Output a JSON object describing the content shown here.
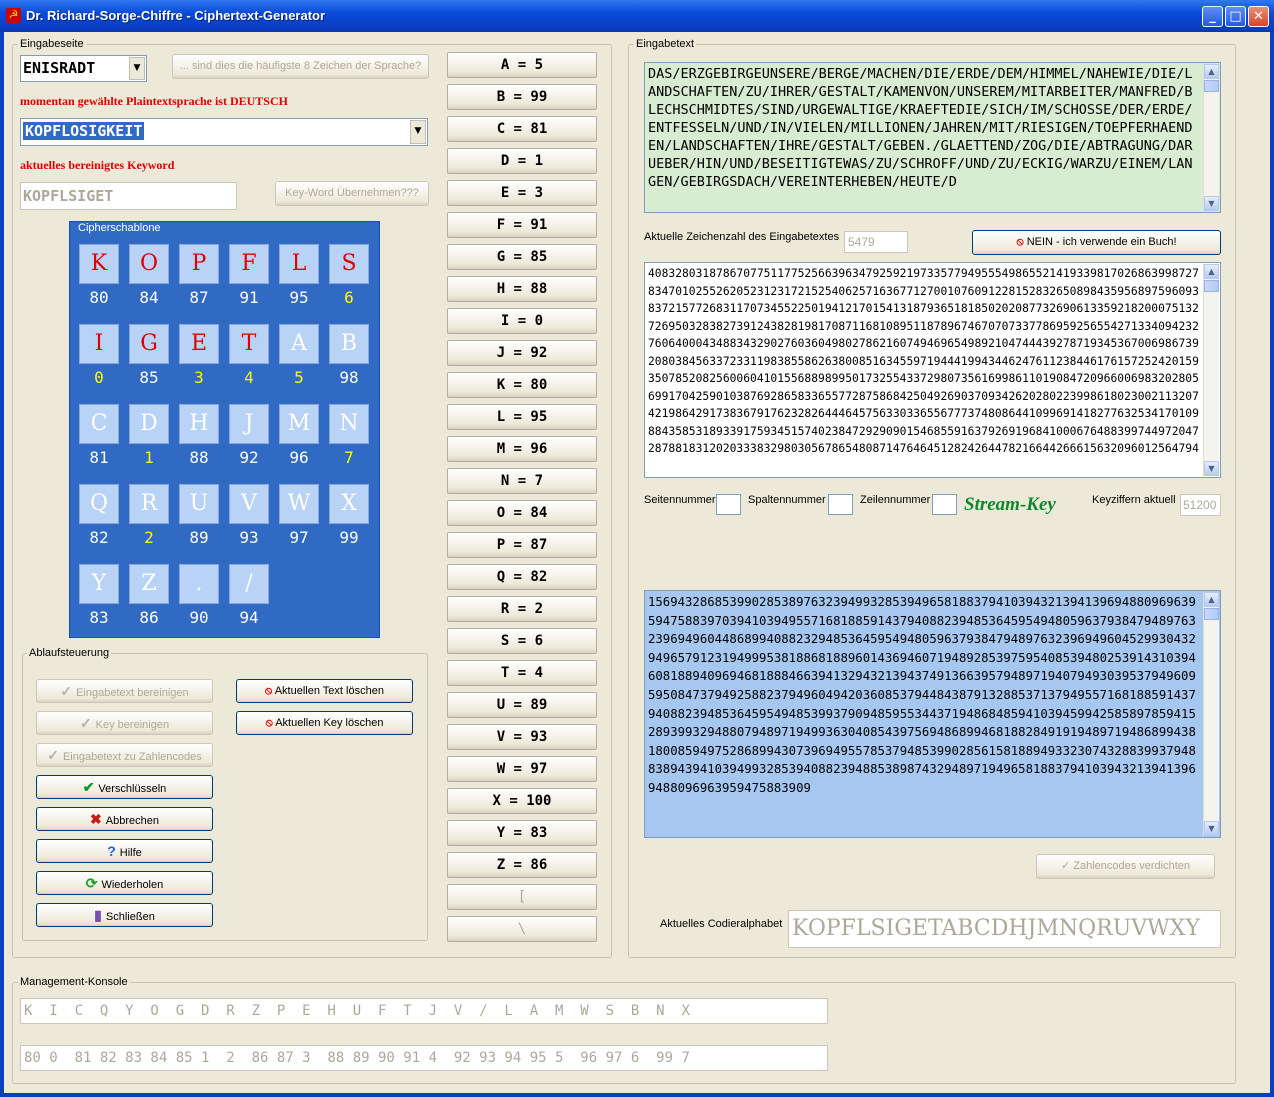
{
  "window": {
    "title": "Dr. Richard-Sorge-Chiffre - Ciphertext-Generator"
  },
  "left": {
    "group_label": "Eingabeseite",
    "combo_top": "ENISRADT",
    "btn_haeufig": "... sind dies die häufigste 8 Zeichen der Sprache?",
    "lang_note": "momentan gewählte Plaintextsprache ist DEUTSCH",
    "keyword_combo": "KOPFLOSIGKEIT",
    "cleaned_label": "aktuelles bereinigtes Keyword",
    "cleaned_value": "KOPFLSIGET",
    "btn_key_uebernehmen": "Key-Word Übernehmen???",
    "cipher_label": "Cipherschablone"
  },
  "cipher_grid": [
    [
      {
        "l": "K",
        "n": "80",
        "r": true,
        "y": false
      },
      {
        "l": "O",
        "n": "84",
        "r": true,
        "y": false
      },
      {
        "l": "P",
        "n": "87",
        "r": true,
        "y": false
      },
      {
        "l": "F",
        "n": "91",
        "r": true,
        "y": false
      },
      {
        "l": "L",
        "n": "95",
        "r": true,
        "y": false
      },
      {
        "l": "S",
        "n": "6",
        "r": true,
        "y": true
      }
    ],
    [
      {
        "l": "I",
        "n": "0",
        "r": true,
        "y": true
      },
      {
        "l": "G",
        "n": "85",
        "r": true,
        "y": false
      },
      {
        "l": "E",
        "n": "3",
        "r": true,
        "y": true
      },
      {
        "l": "T",
        "n": "4",
        "r": true,
        "y": true
      },
      {
        "l": "A",
        "n": "5",
        "r": false,
        "y": true
      },
      {
        "l": "B",
        "n": "98",
        "r": false,
        "y": false
      }
    ],
    [
      {
        "l": "C",
        "n": "81",
        "r": false,
        "y": false
      },
      {
        "l": "D",
        "n": "1",
        "r": false,
        "y": true
      },
      {
        "l": "H",
        "n": "88",
        "r": false,
        "y": false
      },
      {
        "l": "J",
        "n": "92",
        "r": false,
        "y": false
      },
      {
        "l": "M",
        "n": "96",
        "r": false,
        "y": false
      },
      {
        "l": "N",
        "n": "7",
        "r": false,
        "y": true
      }
    ],
    [
      {
        "l": "Q",
        "n": "82",
        "r": false,
        "y": false
      },
      {
        "l": "R",
        "n": "2",
        "r": false,
        "y": true
      },
      {
        "l": "U",
        "n": "89",
        "r": false,
        "y": false
      },
      {
        "l": "V",
        "n": "93",
        "r": false,
        "y": false
      },
      {
        "l": "W",
        "n": "97",
        "r": false,
        "y": false
      },
      {
        "l": "X",
        "n": "99",
        "r": false,
        "y": false
      }
    ],
    [
      {
        "l": "Y",
        "n": "83",
        "r": false,
        "y": false
      },
      {
        "l": "Z",
        "n": "86",
        "r": false,
        "y": false
      },
      {
        "l": ".",
        "n": "90",
        "r": false,
        "y": false
      },
      {
        "l": "/",
        "n": "94",
        "r": false,
        "y": false
      }
    ]
  ],
  "ablauf": {
    "label": "Ablaufsteuerung",
    "buttons": [
      {
        "label": "Eingabetext bereinigen",
        "icon": "check-icon",
        "enabled": false
      },
      {
        "label": "Key bereinigen",
        "icon": "check-icon",
        "enabled": false
      },
      {
        "label": "Eingabetext zu Zahlencodes",
        "icon": "check-icon",
        "enabled": false
      },
      {
        "label": "Verschlüsseln",
        "icon": "green-check-icon",
        "enabled": true
      },
      {
        "label": "Abbrechen",
        "icon": "red-x-icon",
        "enabled": true
      },
      {
        "label": "Hilfe",
        "icon": "question-icon",
        "enabled": true
      },
      {
        "label": "Wiederholen",
        "icon": "refresh-icon",
        "enabled": true
      },
      {
        "label": "Schließen",
        "icon": "door-icon",
        "enabled": true
      }
    ],
    "btn_text_loeschen": "Aktuellen Text löschen",
    "btn_key_loeschen": "Aktuellen Key löschen"
  },
  "letter_buttons": [
    "A = 5",
    "B = 99",
    "C = 81",
    "D = 1",
    "E = 3",
    "F = 91",
    "G = 85",
    "H = 88",
    "I = 0",
    "J = 92",
    "K = 80",
    "L = 95",
    "M = 96",
    "N = 7",
    "O = 84",
    "P = 87",
    "Q = 82",
    "R = 2",
    "S = 6",
    "T = 4",
    "U = 89",
    "V = 93",
    "W = 97",
    "X = 100",
    "Y = 83",
    "Z = 86",
    "[",
    "\\"
  ],
  "right": {
    "group_label": "Eingabetext",
    "input_text": "DAS/ERZGEBIRGEUNSERE/BERGE/MACHEN/DIE/ERDE/DEM/HIMMEL/NAHEWIE/DIE/LANDSCHAFTEN/ZU/IHRER/GESTALT/KAMENVON/UNSEREM/MITARBEITER/MANFRED/BLECHSCHMIDTES/SIND/URGEWALTIGE/KRAEFTEDIE/SICH/IM/SCHOSSE/DER/ERDE/ENTFESSELN/UND/IN/VIELEN/MILLIONEN/JAHREN/MIT/RIESIGEN/TOEPFERHAENDEN/LANDSCHAFTEN/IHRE/GESTALT/GEBEN./GLAETTEND/ZOG/DIE/ABTRAGUNG/DARUEBER/HIN/UND/BESEITIGTEWAS/ZU/SCHROFF/UND/ZU/ECKIG/WARZU/EINEM/LANGEN/GEBIRGSDACH/VEREINTERHEBEN/HEUTE/D",
    "char_count_label": "Aktuelle Zeichenzahl des Eingabetextes",
    "char_count": "5479",
    "btn_nein": "NEIN - ich verwende ein Buch!",
    "number_text": "408328031878670775117752566396347925921973357794955549865521419339817026863998727834701025526205231231721525406257163677127001076091228152832650898435956897596093837215772683117073455225019412170154131879365181850202087732690613359218200075132726950328382739124382819817087116810895118789674670707337786959256554271334094232760640004348834329027603604980278621607494696549892104744439278719345367006986739208038456337233119838558626380085163455971944419943446247611238446176157252420159350785208256006041015568898995017325543372980735616998611019084720966006983202805699170425901038769286583365577287586842504926903709342620280223998618023002113207421986429173836791762328264446457563303365567773748086441099691418277632534170109884358531893391759345157402384729290901546855916379269196841000676488399744972047287881831202033383298030567865480871476464512824264478216644266615632096012564794",
    "seiten_label": "Seitennummer",
    "spalten_label": "Spaltennummer",
    "zeilen_label": "Zeilennummer",
    "stream_key": "Stream-Key",
    "keyziffern_label": "Keyziffern aktuell",
    "keyziffern": "51200",
    "output_text": "156943286853990285389763239499328539496581883794103943213941396948809696395947588397039410394955716818859143794088239485364595494805963793847948976323969496044868994088232948536459549480596379384794897632396949604529930432949657912319499953818868188960143694607194892853975954085394802539143103946081889409694681888466394132943213943749136639579489719407949303953794960959508473794925882379496049420360853794484387913288537137949557168188591437940882394853645954948539937909485955344371948684859410394599425858978594152893993294880794897194993630408543975694868994681882849191948971948689943818008594975286899430739694955785379485399028561581889493323074328839937948838943941039499328539408823948853898743294897194965818837941039432139413969488096963959475883909"
  },
  "codier": {
    "btn_verdichten": "Zahlencodes verdichten",
    "label": "Aktuelles Codieralphabet",
    "value": "KOPFLSIGETABCDHJMNQRUVWXY"
  },
  "management": {
    "label": "Management-Konsole",
    "row1": "K  I  C  Q  Y  O  G  D  R  Z  P  E  H  U  F  T  J  V  /  L  A  M  W  S  B  N  X",
    "row2": "80 0  81 82 83 84 85 1  2  86 87 3  88 89 90 91 4  92 93 94 95 5  96 97 6  99 7"
  }
}
